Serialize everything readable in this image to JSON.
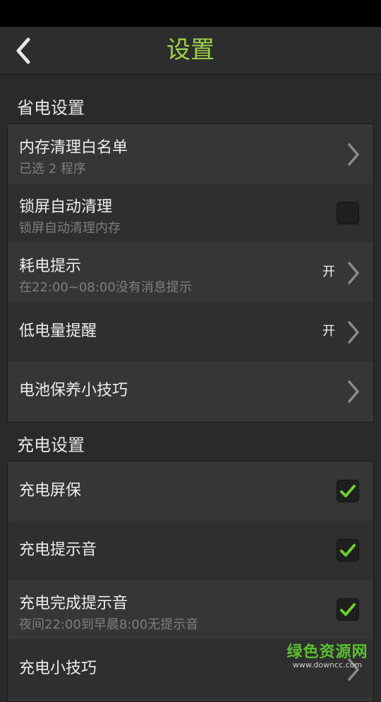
{
  "header": {
    "title": "设置"
  },
  "sections": [
    {
      "title": "省电设置",
      "items": [
        {
          "title": "内存清理白名单",
          "subtitle": "已选 2 程序"
        },
        {
          "title": "锁屏自动清理",
          "subtitle": "锁屏自动清理内存",
          "checked": false
        },
        {
          "title": "耗电提示",
          "subtitle": "在22:00~08:00没有消息提示",
          "state": "开"
        },
        {
          "title": "低电量提醒",
          "state": "开"
        },
        {
          "title": "电池保养小技巧"
        }
      ]
    },
    {
      "title": "充电设置",
      "items": [
        {
          "title": "充电屏保",
          "checked": true
        },
        {
          "title": "充电提示音",
          "checked": true
        },
        {
          "title": "充电完成提示音",
          "subtitle": "夜间22:00到早晨8:00无提示音",
          "checked": true
        },
        {
          "title": "充电小技巧"
        }
      ]
    }
  ],
  "watermark": {
    "name": "绿色资源网",
    "url": "www.downcc.com"
  },
  "colors": {
    "accent": "#9fd24a",
    "check": "#6ccf2e",
    "watermark": "#5bbf32"
  }
}
